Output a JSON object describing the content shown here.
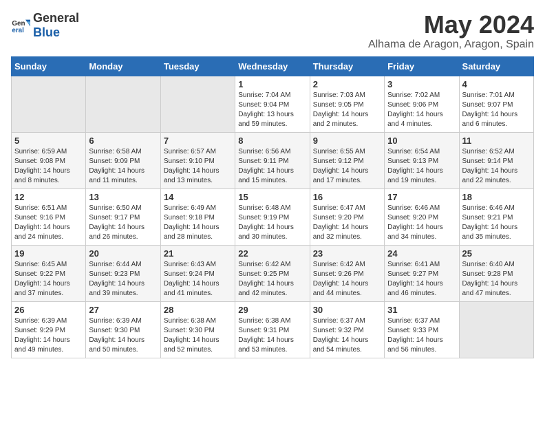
{
  "header": {
    "logo_general": "General",
    "logo_blue": "Blue",
    "month_title": "May 2024",
    "location": "Alhama de Aragon, Aragon, Spain"
  },
  "weekdays": [
    "Sunday",
    "Monday",
    "Tuesday",
    "Wednesday",
    "Thursday",
    "Friday",
    "Saturday"
  ],
  "weeks": [
    [
      {
        "day": "",
        "info": ""
      },
      {
        "day": "",
        "info": ""
      },
      {
        "day": "",
        "info": ""
      },
      {
        "day": "1",
        "info": "Sunrise: 7:04 AM\nSunset: 9:04 PM\nDaylight: 13 hours\nand 59 minutes."
      },
      {
        "day": "2",
        "info": "Sunrise: 7:03 AM\nSunset: 9:05 PM\nDaylight: 14 hours\nand 2 minutes."
      },
      {
        "day": "3",
        "info": "Sunrise: 7:02 AM\nSunset: 9:06 PM\nDaylight: 14 hours\nand 4 minutes."
      },
      {
        "day": "4",
        "info": "Sunrise: 7:01 AM\nSunset: 9:07 PM\nDaylight: 14 hours\nand 6 minutes."
      }
    ],
    [
      {
        "day": "5",
        "info": "Sunrise: 6:59 AM\nSunset: 9:08 PM\nDaylight: 14 hours\nand 8 minutes."
      },
      {
        "day": "6",
        "info": "Sunrise: 6:58 AM\nSunset: 9:09 PM\nDaylight: 14 hours\nand 11 minutes."
      },
      {
        "day": "7",
        "info": "Sunrise: 6:57 AM\nSunset: 9:10 PM\nDaylight: 14 hours\nand 13 minutes."
      },
      {
        "day": "8",
        "info": "Sunrise: 6:56 AM\nSunset: 9:11 PM\nDaylight: 14 hours\nand 15 minutes."
      },
      {
        "day": "9",
        "info": "Sunrise: 6:55 AM\nSunset: 9:12 PM\nDaylight: 14 hours\nand 17 minutes."
      },
      {
        "day": "10",
        "info": "Sunrise: 6:54 AM\nSunset: 9:13 PM\nDaylight: 14 hours\nand 19 minutes."
      },
      {
        "day": "11",
        "info": "Sunrise: 6:52 AM\nSunset: 9:14 PM\nDaylight: 14 hours\nand 22 minutes."
      }
    ],
    [
      {
        "day": "12",
        "info": "Sunrise: 6:51 AM\nSunset: 9:16 PM\nDaylight: 14 hours\nand 24 minutes."
      },
      {
        "day": "13",
        "info": "Sunrise: 6:50 AM\nSunset: 9:17 PM\nDaylight: 14 hours\nand 26 minutes."
      },
      {
        "day": "14",
        "info": "Sunrise: 6:49 AM\nSunset: 9:18 PM\nDaylight: 14 hours\nand 28 minutes."
      },
      {
        "day": "15",
        "info": "Sunrise: 6:48 AM\nSunset: 9:19 PM\nDaylight: 14 hours\nand 30 minutes."
      },
      {
        "day": "16",
        "info": "Sunrise: 6:47 AM\nSunset: 9:20 PM\nDaylight: 14 hours\nand 32 minutes."
      },
      {
        "day": "17",
        "info": "Sunrise: 6:46 AM\nSunset: 9:20 PM\nDaylight: 14 hours\nand 34 minutes."
      },
      {
        "day": "18",
        "info": "Sunrise: 6:46 AM\nSunset: 9:21 PM\nDaylight: 14 hours\nand 35 minutes."
      }
    ],
    [
      {
        "day": "19",
        "info": "Sunrise: 6:45 AM\nSunset: 9:22 PM\nDaylight: 14 hours\nand 37 minutes."
      },
      {
        "day": "20",
        "info": "Sunrise: 6:44 AM\nSunset: 9:23 PM\nDaylight: 14 hours\nand 39 minutes."
      },
      {
        "day": "21",
        "info": "Sunrise: 6:43 AM\nSunset: 9:24 PM\nDaylight: 14 hours\nand 41 minutes."
      },
      {
        "day": "22",
        "info": "Sunrise: 6:42 AM\nSunset: 9:25 PM\nDaylight: 14 hours\nand 42 minutes."
      },
      {
        "day": "23",
        "info": "Sunrise: 6:42 AM\nSunset: 9:26 PM\nDaylight: 14 hours\nand 44 minutes."
      },
      {
        "day": "24",
        "info": "Sunrise: 6:41 AM\nSunset: 9:27 PM\nDaylight: 14 hours\nand 46 minutes."
      },
      {
        "day": "25",
        "info": "Sunrise: 6:40 AM\nSunset: 9:28 PM\nDaylight: 14 hours\nand 47 minutes."
      }
    ],
    [
      {
        "day": "26",
        "info": "Sunrise: 6:39 AM\nSunset: 9:29 PM\nDaylight: 14 hours\nand 49 minutes."
      },
      {
        "day": "27",
        "info": "Sunrise: 6:39 AM\nSunset: 9:30 PM\nDaylight: 14 hours\nand 50 minutes."
      },
      {
        "day": "28",
        "info": "Sunrise: 6:38 AM\nSunset: 9:30 PM\nDaylight: 14 hours\nand 52 minutes."
      },
      {
        "day": "29",
        "info": "Sunrise: 6:38 AM\nSunset: 9:31 PM\nDaylight: 14 hours\nand 53 minutes."
      },
      {
        "day": "30",
        "info": "Sunrise: 6:37 AM\nSunset: 9:32 PM\nDaylight: 14 hours\nand 54 minutes."
      },
      {
        "day": "31",
        "info": "Sunrise: 6:37 AM\nSunset: 9:33 PM\nDaylight: 14 hours\nand 56 minutes."
      },
      {
        "day": "",
        "info": ""
      }
    ]
  ]
}
